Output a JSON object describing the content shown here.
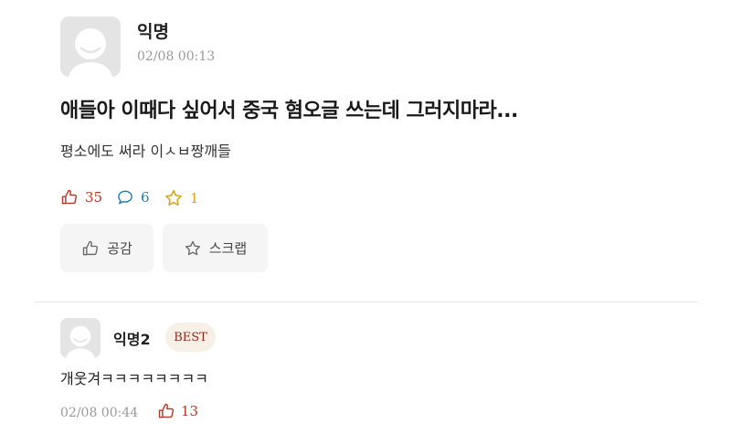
{
  "post": {
    "author": "익명",
    "time": "02/08 00:13",
    "title": "애들아 이때다 싶어서 중국 혐오글 쓰는데 그러지마라...",
    "body": "평소에도 써라 이ㅅㅂ짱깨들",
    "stats": {
      "likes": "35",
      "comments": "6",
      "scraps": "1"
    },
    "actions": {
      "like_label": "공감",
      "scrap_label": "스크랩"
    }
  },
  "comment": {
    "author": "익명2",
    "badge": "BEST",
    "text": "개웃겨ㅋㅋㅋㅋㅋㅋㅋㅋ",
    "time": "02/08 00:44",
    "likes": "13"
  },
  "colors": {
    "like": "#b33a2a",
    "comment": "#1e7eb4",
    "scrap": "#d8a51c",
    "badge_bg": "#f6f0e7"
  },
  "icons": [
    "avatar-icon",
    "thumbs-up-icon",
    "speech-bubble-icon",
    "star-icon"
  ]
}
